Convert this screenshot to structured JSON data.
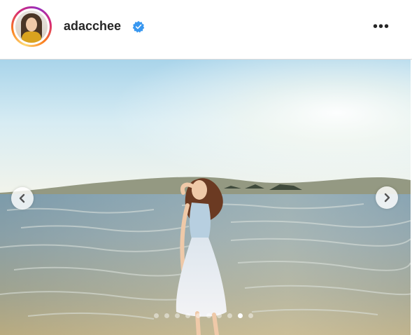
{
  "post_header": {
    "username": "adacchee",
    "verified": true,
    "avatar_icon": "profile-avatar",
    "more_icon": "more-options-icon",
    "more_label": "•••"
  },
  "carousel": {
    "prev_icon": "chevron-left-icon",
    "next_icon": "chevron-right-icon",
    "total_images": 10,
    "active_index": 8
  },
  "colors": {
    "verified_blue": "#3897f0",
    "story_ring_start": "#feda75",
    "story_ring_end": "#962fbf"
  }
}
